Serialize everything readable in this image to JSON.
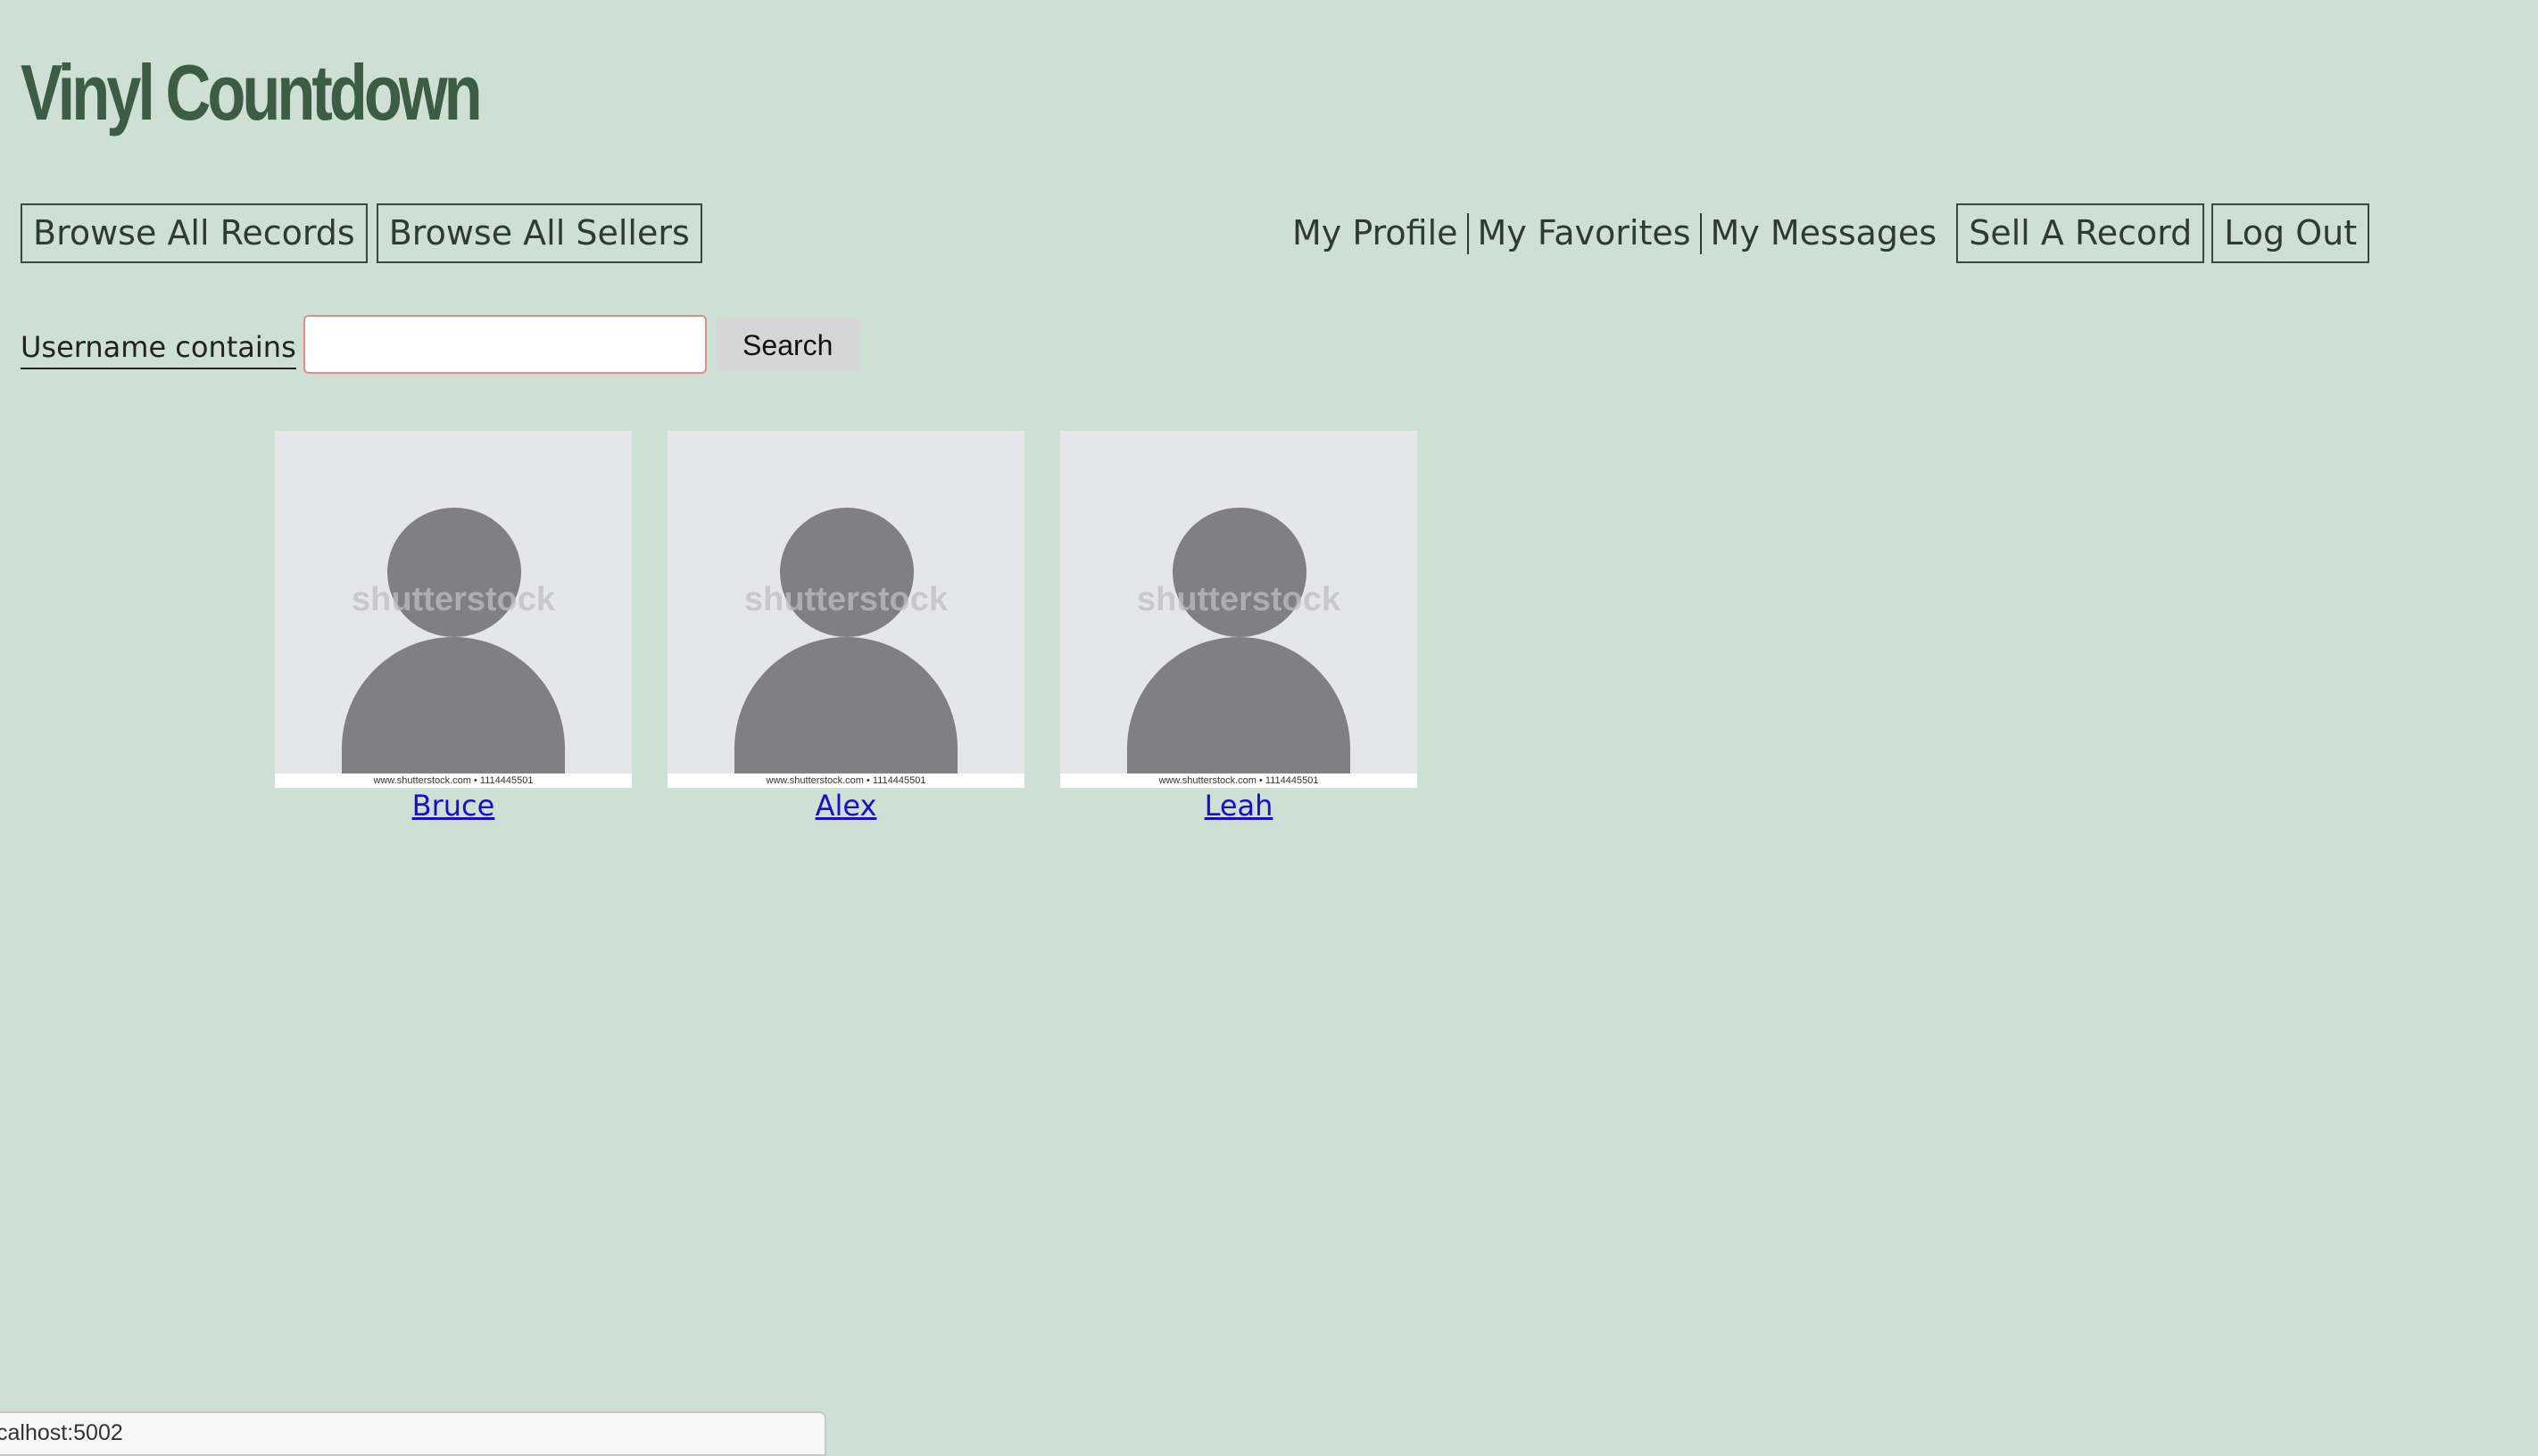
{
  "header": {
    "title": "Vinyl Countdown"
  },
  "nav": {
    "browse_records": "Browse All Records",
    "browse_sellers": "Browse All Sellers",
    "my_profile": "My Profile",
    "my_favorites": "My Favorites",
    "my_messages": "My Messages",
    "sell_record": "Sell A Record",
    "log_out": "Log Out"
  },
  "search": {
    "label": "Username contains",
    "value": "",
    "button_label": "Search"
  },
  "sellers": [
    {
      "name": "Bruce",
      "watermark": "shutterstock",
      "stock_caption": "www.shutterstock.com • 1114445501"
    },
    {
      "name": "Alex",
      "watermark": "shutterstock",
      "stock_caption": "www.shutterstock.com • 1114445501"
    },
    {
      "name": "Leah",
      "watermark": "shutterstock",
      "stock_caption": "www.shutterstock.com • 1114445501"
    }
  ],
  "status_bar": {
    "url": "calhost:5002"
  },
  "colors": {
    "background": "#cde0d3",
    "title": "#3c5c44",
    "link": "#1a0dcc",
    "avatar_fill": "#808084",
    "input_border": "#e38a8a"
  },
  "icons": {
    "avatar": "user-placeholder-icon"
  }
}
